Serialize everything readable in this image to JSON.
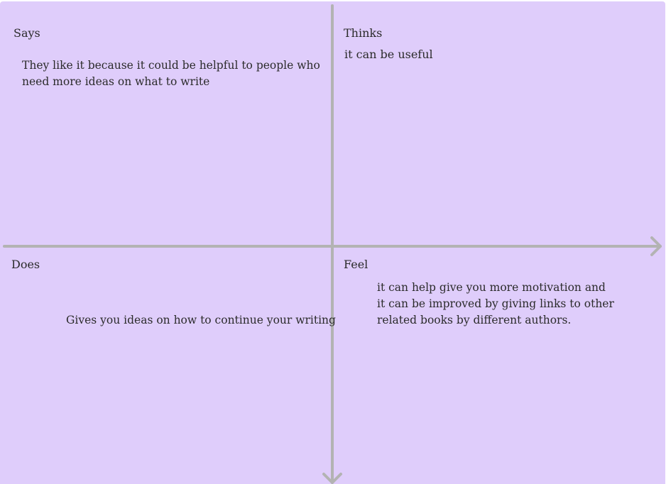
{
  "quadrants": {
    "says": {
      "title": "Says",
      "notes": [
        "They like it because it could be helpful to people who need more ideas on what to write"
      ]
    },
    "thinks": {
      "title": "Thinks",
      "notes": [
        "it can be useful"
      ]
    },
    "does": {
      "title": "Does",
      "notes": [
        "Gives you ideas on how to continue your writing"
      ]
    },
    "feel": {
      "title": "Feel",
      "notes": [
        "it can help give you more motivation and",
        "it can be improved by giving links to other related books by different authors."
      ]
    }
  },
  "colors": {
    "background": "#dfcdfb",
    "axis": "#b3b3b3",
    "text": "#2b2b2b"
  }
}
